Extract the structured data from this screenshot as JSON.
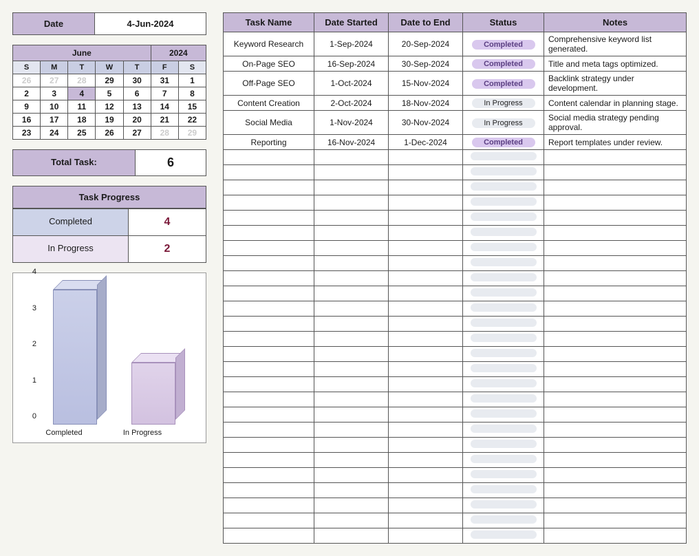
{
  "date": {
    "label": "Date",
    "value": "4-Jun-2024"
  },
  "calendar": {
    "month": "June",
    "year": "2024",
    "dow": [
      "S",
      "M",
      "T",
      "W",
      "T",
      "F",
      "S"
    ],
    "weeks": [
      [
        {
          "d": "26",
          "dim": true
        },
        {
          "d": "27",
          "dim": true
        },
        {
          "d": "28",
          "dim": true
        },
        {
          "d": "29"
        },
        {
          "d": "30"
        },
        {
          "d": "31"
        },
        {
          "d": "1"
        }
      ],
      [
        {
          "d": "2"
        },
        {
          "d": "3"
        },
        {
          "d": "4",
          "hi": true
        },
        {
          "d": "5"
        },
        {
          "d": "6"
        },
        {
          "d": "7"
        },
        {
          "d": "8"
        }
      ],
      [
        {
          "d": "9"
        },
        {
          "d": "10"
        },
        {
          "d": "11"
        },
        {
          "d": "12"
        },
        {
          "d": "13"
        },
        {
          "d": "14"
        },
        {
          "d": "15"
        }
      ],
      [
        {
          "d": "16"
        },
        {
          "d": "17"
        },
        {
          "d": "18"
        },
        {
          "d": "19"
        },
        {
          "d": "20"
        },
        {
          "d": "21"
        },
        {
          "d": "22"
        }
      ],
      [
        {
          "d": "23"
        },
        {
          "d": "24"
        },
        {
          "d": "25"
        },
        {
          "d": "26"
        },
        {
          "d": "27"
        },
        {
          "d": "28",
          "dim": true
        },
        {
          "d": "29",
          "dim": true
        }
      ]
    ]
  },
  "total_task": {
    "label": "Total Task:",
    "value": "6"
  },
  "task_progress": {
    "title": "Task Progress",
    "rows": [
      {
        "label": "Completed",
        "value": "4"
      },
      {
        "label": "In Progress",
        "value": "2"
      }
    ]
  },
  "chart_data": {
    "type": "bar",
    "categories": [
      "Completed",
      "In Progress"
    ],
    "values": [
      3.7,
      1.7
    ],
    "ylim": [
      0,
      4
    ],
    "yticks": [
      0,
      1,
      2,
      3,
      4
    ]
  },
  "task_table": {
    "headers": [
      "Task Name",
      "Date Started",
      "Date to End",
      "Status",
      "Notes"
    ],
    "rows": [
      {
        "name": "Keyword Research",
        "start": "1-Sep-2024",
        "end": "20-Sep-2024",
        "status": "Completed",
        "status_class": "completed",
        "notes": "Comprehensive keyword list generated."
      },
      {
        "name": "On-Page SEO",
        "start": "16-Sep-2024",
        "end": "30-Sep-2024",
        "status": "Completed",
        "status_class": "completed",
        "notes": "Title and meta tags optimized."
      },
      {
        "name": "Off-Page SEO",
        "start": "1-Oct-2024",
        "end": "15-Nov-2024",
        "status": "Completed",
        "status_class": "completed",
        "notes": "Backlink strategy under development."
      },
      {
        "name": "Content Creation",
        "start": "2-Oct-2024",
        "end": "18-Nov-2024",
        "status": "In Progress",
        "status_class": "in-progress",
        "notes": "Content calendar in planning stage."
      },
      {
        "name": "Social Media",
        "start": "1-Nov-2024",
        "end": "30-Nov-2024",
        "status": "In Progress",
        "status_class": "in-progress",
        "notes": "Social media strategy pending approval."
      },
      {
        "name": "Reporting",
        "start": "16-Nov-2024",
        "end": "1-Dec-2024",
        "status": "Completed",
        "status_class": "completed",
        "notes": "Report templates under review."
      }
    ],
    "empty_rows": 26
  }
}
